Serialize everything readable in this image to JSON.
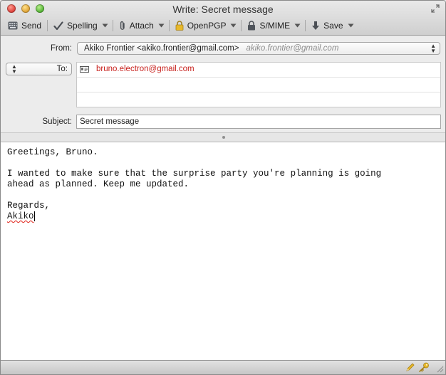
{
  "window": {
    "title": "Write: Secret message"
  },
  "toolbar": {
    "send_label": "Send",
    "spelling_label": "Spelling",
    "attach_label": "Attach",
    "openpgp_label": "OpenPGP",
    "smime_label": "S/MIME",
    "save_label": "Save"
  },
  "header": {
    "from_label": "From:",
    "from_value": "Akiko Frontier <akiko.frontier@gmail.com>",
    "from_alias": "akiko.frontier@gmail.com",
    "to_label": "To:",
    "recipients": [
      "bruno.electron@gmail.com",
      "",
      ""
    ],
    "subject_label": "Subject:",
    "subject_value": "Secret message"
  },
  "body": {
    "lines": [
      "Greetings, Bruno.",
      "",
      "I wanted to make sure that the surprise party you're planning is going",
      "ahead as planned. Keep me updated.",
      "",
      "Regards,"
    ],
    "signature_word": "Akiko"
  },
  "colors": {
    "recipient_text": "#c8221e",
    "spell_error_underline": "#e0241b",
    "openpgp_lock": "#e8b92a"
  },
  "icons": {
    "send": "send-icon",
    "spelling": "checkmark-icon",
    "attach": "paperclip-icon",
    "openpgp": "padlock-icon",
    "smime": "padlock-icon",
    "save": "down-arrow-icon",
    "status_pen": "pen-icon",
    "status_key": "key-icon"
  }
}
